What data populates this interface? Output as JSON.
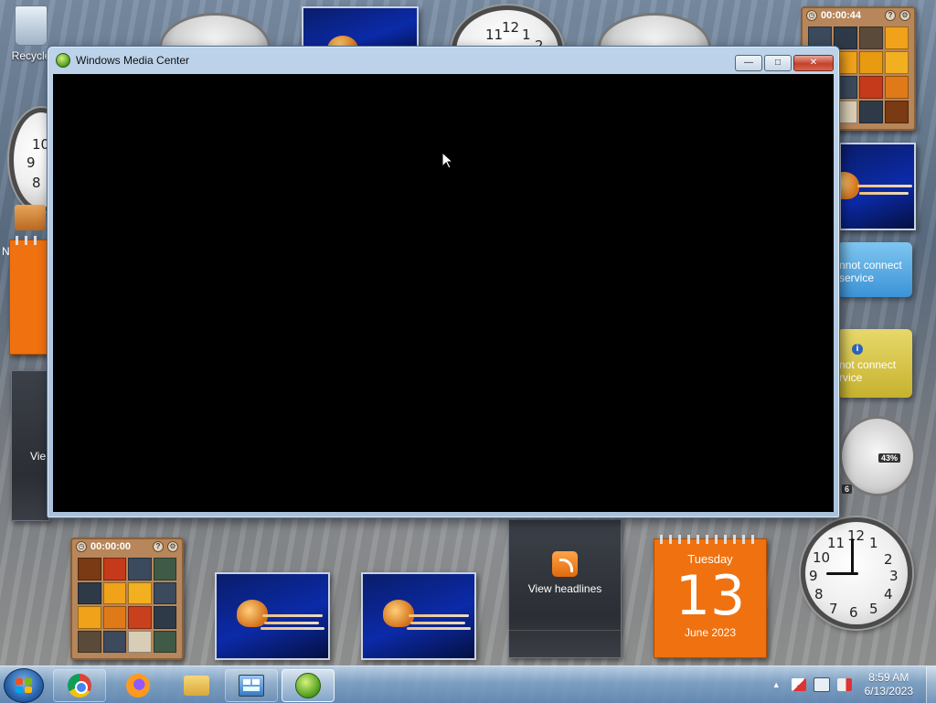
{
  "desktop": {
    "recycle_bin_label": "Recycle",
    "left_gadget_partial_text": "Vie",
    "left_gadget_partial_letter": "N"
  },
  "window": {
    "title": "Windows Media Center",
    "buttons": {
      "minimize": "—",
      "maximize": "□",
      "close": "✕"
    }
  },
  "gadgets": {
    "puzzle_top": {
      "timer": "00:00:44",
      "help": "?",
      "settings": "⚙"
    },
    "puzzle_bottom": {
      "timer": "00:00:00",
      "help": "?",
      "settings": "⚙"
    },
    "weather_1": {
      "text_line1": "nnot connect",
      "text_line2": "service"
    },
    "weather_2": {
      "text_line1": "not connect",
      "text_line2": "rvice",
      "info_icon": "i"
    },
    "meter": {
      "label": "43%",
      "partial_value": "6"
    },
    "feed": {
      "label": "View headlines"
    },
    "calendar": {
      "weekday": "Tuesday",
      "day": "13",
      "month_year": "June 2023"
    },
    "clock_numbers": [
      "12",
      "1",
      "2",
      "3",
      "4",
      "5",
      "6",
      "7",
      "8",
      "9",
      "10",
      "11"
    ],
    "left_clock_numbers": [
      "10",
      "9",
      "8"
    ],
    "top_clock_numbers": [
      "11",
      "12",
      "1",
      "2"
    ]
  },
  "taskbar": {
    "time": "8:59 AM",
    "date": "6/13/2023",
    "tray_arrow": "▲",
    "apps": [
      "chrome-icon",
      "firefox-icon",
      "file-explorer-icon",
      "control-panel-icon",
      "windows-media-center-icon"
    ]
  },
  "colors": {
    "calendar_orange": "#f0710f",
    "window_frame": "#bcd3ea",
    "close_red": "#c5412a",
    "taskbar_blue": "#5f87b4"
  }
}
